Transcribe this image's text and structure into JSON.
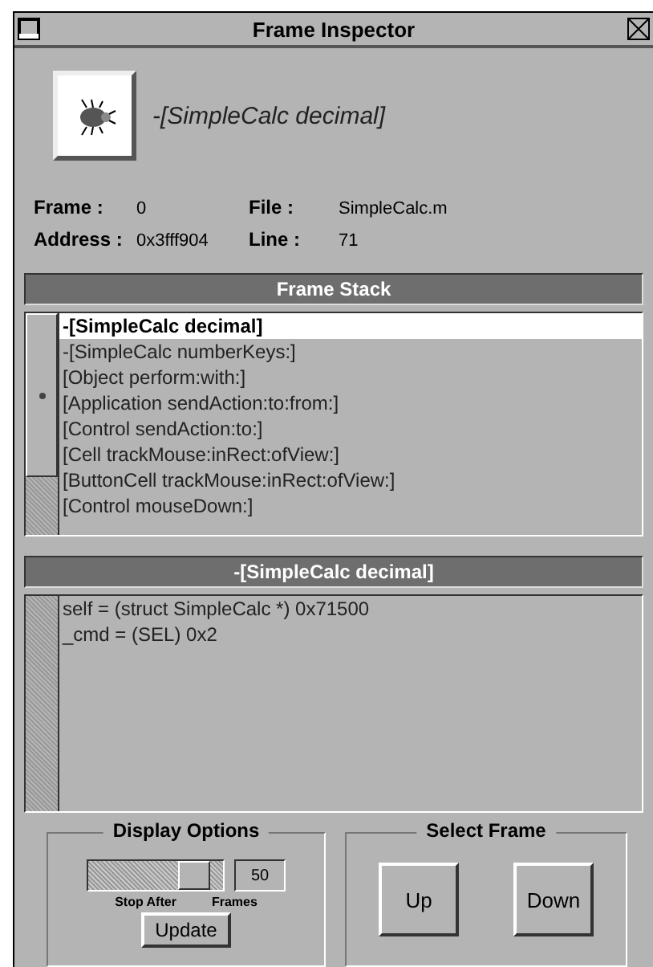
{
  "window": {
    "title": "Frame Inspector"
  },
  "header": {
    "method": "-[SimpleCalc decimal]"
  },
  "info": [
    {
      "label": "Frame :",
      "value": "0"
    },
    {
      "label": "File :",
      "value": "SimpleCalc.m"
    },
    {
      "label": "Address :",
      "value": "0x3fff904"
    },
    {
      "label": "Line :",
      "value": "71"
    }
  ],
  "frame_stack": {
    "title": "Frame Stack",
    "items": [
      {
        "label": "-[SimpleCalc decimal]",
        "selected": true
      },
      {
        "label": "-[SimpleCalc numberKeys:]",
        "selected": false
      },
      {
        "label": "[Object perform:with:]",
        "selected": false
      },
      {
        "label": "[Application sendAction:to:from:]",
        "selected": false
      },
      {
        "label": "[Control sendAction:to:]",
        "selected": false
      },
      {
        "label": "[Cell trackMouse:inRect:ofView:]",
        "selected": false
      },
      {
        "label": "[ButtonCell trackMouse:inRect:ofView:]",
        "selected": false
      },
      {
        "label": "[Control mouseDown:]",
        "selected": false
      }
    ]
  },
  "variables": {
    "title": "-[SimpleCalc decimal]",
    "lines": [
      "self = (struct SimpleCalc *) 0x71500",
      "_cmd = (SEL) 0x2"
    ]
  },
  "display_options": {
    "title": "Display Options",
    "slider": {
      "level": 0.88,
      "label": "Stop After"
    },
    "frames_value": "50",
    "frames_label": "Frames",
    "update_button": "Update"
  },
  "select_frame": {
    "title": "Select Frame",
    "buttons": [
      "Up",
      "Down"
    ]
  }
}
